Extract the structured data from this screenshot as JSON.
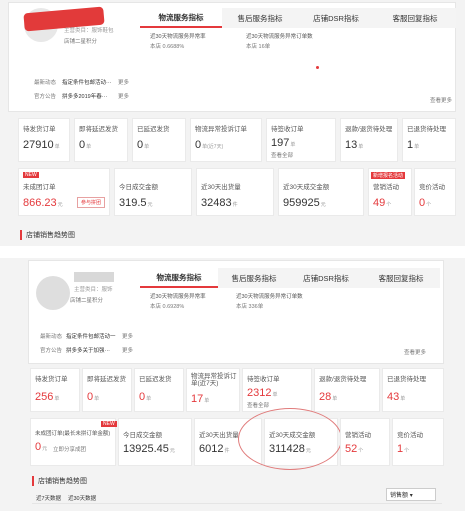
{
  "top": {
    "store_name_hidden": "",
    "store_id_label": "主营类目：服饰鞋包",
    "store_level": "店铺二星积分",
    "latest_dynamic_label": "最新动态",
    "latest_dynamic_text": "指定条件包邮活动···",
    "more": "更多",
    "notice_label": "官方公告",
    "notice_text": "拼多多2019年春···",
    "notice_more": "更多",
    "tabs": [
      "物流服务指标",
      "售后服务指标",
      "店铺DSR指标",
      "客服回复指标"
    ],
    "logistics_text_1": "近30天物流服务异常率",
    "logistics_value_1": "本店 0.6688%",
    "logistics_text_2": "近30天物流服务异常订单数",
    "logistics_value_2": "本店 16单",
    "view_more": "查看更多",
    "row1": [
      {
        "label": "待发货订单",
        "value": "27910",
        "unit": "单"
      },
      {
        "label": "即将延迟发货",
        "value": "0",
        "unit": "单"
      },
      {
        "label": "已延迟发货",
        "value": "0",
        "unit": "单"
      },
      {
        "label": "物流异常投诉订单",
        "value": "0",
        "unit": "单(近7天)"
      },
      {
        "label": "待签收订单",
        "value": "197",
        "unit": "单",
        "sub": "查看全部"
      },
      {
        "label": "退款/退货待处理",
        "value": "13",
        "unit": "单"
      },
      {
        "label": "已退货待处理",
        "value": "1",
        "unit": "单"
      }
    ],
    "row2": [
      {
        "label": "未成团订单",
        "value": "866.23",
        "unit": "元",
        "badge": "NEW",
        "button": "参与拼团"
      },
      {
        "label": "今日成交金额",
        "value": "319.5",
        "unit": "元"
      },
      {
        "label": "近30天出货量",
        "value": "32483",
        "unit": "件"
      },
      {
        "label": "近30天成交金额",
        "value": "959925",
        "unit": "元"
      },
      {
        "label": "营销活动",
        "value": "49",
        "unit": "个",
        "badge": "新增报名活动"
      },
      {
        "label": "竞价活动",
        "value": "0",
        "unit": "个"
      }
    ],
    "section": "店铺销售趋势图"
  },
  "bottom": {
    "store_id_label": "主营类目：服饰",
    "store_level": "店铺二星积分",
    "latest_dynamic_label": "最新动态",
    "latest_dynamic_text": "指定条件包邮活动一",
    "more": "更多",
    "notice_label": "官方公告",
    "notice_text": "拼多多关于加强···",
    "notice_more": "更多",
    "tabs": [
      "物流服务指标",
      "售后服务指标",
      "店铺DSR指标",
      "客服回复指标"
    ],
    "logistics_text_1": "近30天物流服务异常率",
    "logistics_value_1": "本店 0.6928%",
    "logistics_text_2": "近30天物流服务异常订单数",
    "logistics_value_2": "本店 336单",
    "view_more": "查看更多",
    "row1": [
      {
        "label": "待发货订单",
        "value": "256",
        "unit": "单"
      },
      {
        "label": "即将延迟发货",
        "value": "0",
        "unit": "单"
      },
      {
        "label": "已延迟发货",
        "value": "0",
        "unit": "单"
      },
      {
        "label": "物流异常投诉订单(近7天)",
        "value": "17",
        "unit": "单"
      },
      {
        "label": "待签收订单",
        "value": "2312",
        "unit": "单",
        "sub": "查看全部"
      },
      {
        "label": "退款/退货待处理",
        "value": "28",
        "unit": "单"
      },
      {
        "label": "已退货待处理",
        "value": "43",
        "unit": "单"
      }
    ],
    "row2": [
      {
        "label": "未成团订单(最长未拼订单金额)",
        "value": "0",
        "unit": "元",
        "badge": "NEW",
        "sub": "立即分享成团"
      },
      {
        "label": "今日成交金额",
        "value": "13925.45",
        "unit": "元"
      },
      {
        "label": "近30天出货量",
        "value": "6012",
        "unit": "件"
      },
      {
        "label": "近30天成交金额",
        "value": "311428",
        "unit": "元"
      },
      {
        "label": "营销活动",
        "value": "52",
        "unit": "个"
      },
      {
        "label": "竞价活动",
        "value": "1",
        "unit": "个"
      }
    ],
    "section": "店铺销售趋势图",
    "trend_tab": "近7天数据",
    "trend_tab2": "近30天数据",
    "select": "销售额"
  }
}
